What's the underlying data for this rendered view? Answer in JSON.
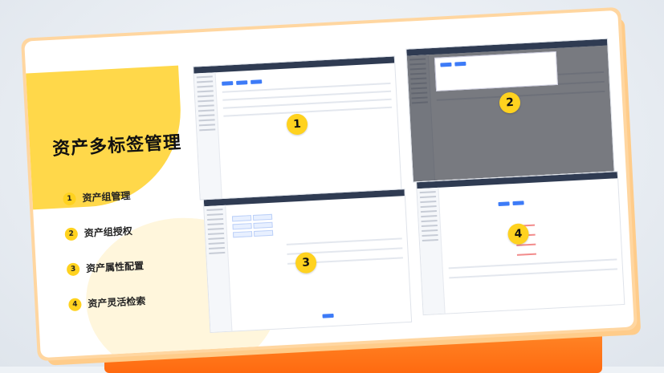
{
  "title": "资产多标签管理",
  "features": [
    {
      "num": "1",
      "label": "资产组管理"
    },
    {
      "num": "2",
      "label": "资产组授权"
    },
    {
      "num": "3",
      "label": "资产属性配置"
    },
    {
      "num": "4",
      "label": "资产灵活检索"
    }
  ],
  "badges": [
    "1",
    "2",
    "3",
    "4"
  ],
  "colors": {
    "accent": "#ffd21f",
    "stage": "#ff7a1a",
    "primary": "#3d7bf7",
    "topbar": "#2f3b52"
  }
}
